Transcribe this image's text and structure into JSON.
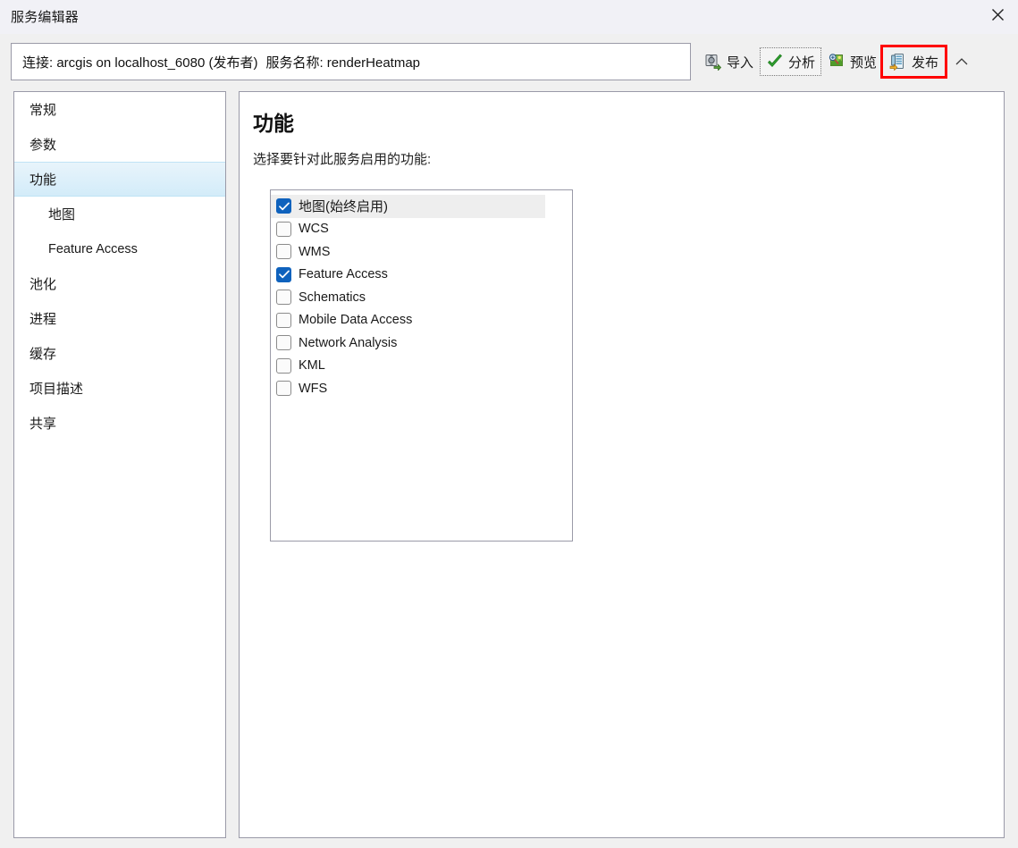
{
  "window": {
    "title": "服务编辑器",
    "close_icon": "close-icon"
  },
  "connection": {
    "label": "连接:",
    "server": "arcgis on localhost_6080 (发布者)",
    "service_label": "服务名称:",
    "service_name": "renderHeatmap",
    "full_text": "连接: arcgis on localhost_6080 (发布者)  服务名称: renderHeatmap"
  },
  "toolbar": {
    "buttons": [
      {
        "label": "导入",
        "icon": "import-icon",
        "state": "normal"
      },
      {
        "label": "分析",
        "icon": "analyze-check-icon",
        "state": "focused"
      },
      {
        "label": "预览",
        "icon": "preview-icon",
        "state": "normal"
      },
      {
        "label": "发布",
        "icon": "publish-icon",
        "state": "highlighted-red"
      }
    ],
    "collapse_icon": "chevron-up-icon",
    "highlight_color": "#ff0000"
  },
  "sidebar": {
    "items": [
      {
        "label": "常规",
        "level": 0,
        "selected": false
      },
      {
        "label": "参数",
        "level": 0,
        "selected": false
      },
      {
        "label": "功能",
        "level": 0,
        "selected": true
      },
      {
        "label": "地图",
        "level": 1,
        "selected": false
      },
      {
        "label": "Feature Access",
        "level": 1,
        "selected": false
      },
      {
        "label": "池化",
        "level": 0,
        "selected": false
      },
      {
        "label": "进程",
        "level": 0,
        "selected": false
      },
      {
        "label": "缓存",
        "level": 0,
        "selected": false
      },
      {
        "label": "项目描述",
        "level": 0,
        "selected": false
      },
      {
        "label": "共享",
        "level": 0,
        "selected": false
      }
    ],
    "selected_bg": "#d3ecf9"
  },
  "main": {
    "title": "功能",
    "description": "选择要针对此服务启用的功能:",
    "capabilities": [
      {
        "label": "地图(始终启用)",
        "checked": true,
        "selected": true,
        "cjk": true
      },
      {
        "label": "WCS",
        "checked": false,
        "selected": false,
        "cjk": false
      },
      {
        "label": "WMS",
        "checked": false,
        "selected": false,
        "cjk": false
      },
      {
        "label": "Feature Access",
        "checked": true,
        "selected": false,
        "cjk": false
      },
      {
        "label": "Schematics",
        "checked": false,
        "selected": false,
        "cjk": false
      },
      {
        "label": "Mobile Data Access",
        "checked": false,
        "selected": false,
        "cjk": false
      },
      {
        "label": "Network Analysis",
        "checked": false,
        "selected": false,
        "cjk": false
      },
      {
        "label": "KML",
        "checked": false,
        "selected": false,
        "cjk": false
      },
      {
        "label": "WFS",
        "checked": false,
        "selected": false,
        "cjk": false
      }
    ],
    "checkbox_on_color": "#0f62bd",
    "row_selected_bg": "#eeeeee"
  }
}
